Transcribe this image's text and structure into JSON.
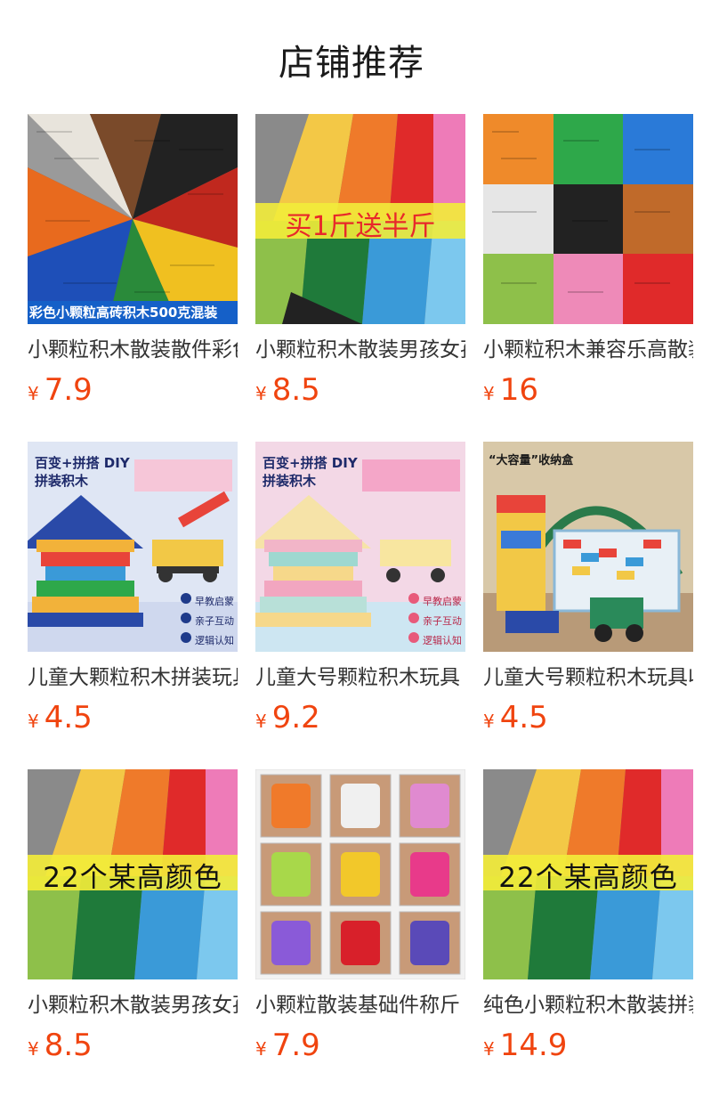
{
  "page_title": "店铺推荐",
  "products": [
    {
      "name": "小颗粒积木散装散件彩色",
      "currency": "¥",
      "price": "7.9",
      "overlay": "彩色小颗粒高砖积木500克混装",
      "image": "colorful-bricks-pile"
    },
    {
      "name": "小颗粒积木散装男孩女孩",
      "currency": "¥",
      "price": "8.5",
      "overlay": "买1斤送半斤",
      "image": "rainbow-bricks"
    },
    {
      "name": "小颗粒积木兼容乐高散装",
      "currency": "¥",
      "price": "16",
      "overlay": "",
      "image": "brick-color-grid"
    },
    {
      "name": "儿童大颗粒积木拼装玩具",
      "currency": "¥",
      "price": "4.5",
      "overlay": "百变+拼搭 DIY 拼装积木",
      "image": "pyramid-build-blue",
      "tags": [
        "早教启蒙",
        "亲子互动",
        "逻辑认知"
      ]
    },
    {
      "name": "儿童大号颗粒积木玩具",
      "currency": "¥",
      "price": "9.2",
      "overlay": "百变+拼搭 DIY 拼装积木",
      "image": "pyramid-build-pastel",
      "tags": [
        "早教启蒙",
        "亲子互动",
        "逻辑认知"
      ]
    },
    {
      "name": "儿童大号颗粒积木玩具收纳",
      "currency": "¥",
      "price": "4.5",
      "overlay": "“大容量”收纳盒",
      "image": "storage-box-bricks"
    },
    {
      "name": "小颗粒积木散装男孩女孩",
      "currency": "¥",
      "price": "8.5",
      "overlay": "22个某高颜色",
      "image": "rainbow-bricks-2"
    },
    {
      "name": "小颗粒散装基础件称斤",
      "currency": "¥",
      "price": "7.9",
      "overlay": "",
      "image": "bagged-bricks-grid"
    },
    {
      "name": "纯色小颗粒积木散装拼装",
      "currency": "¥",
      "price": "14.9",
      "overlay": "22个某高颜色",
      "image": "rainbow-bricks-3"
    }
  ],
  "colors": {
    "price": "#f0440f",
    "title": "#1a1a1a"
  }
}
